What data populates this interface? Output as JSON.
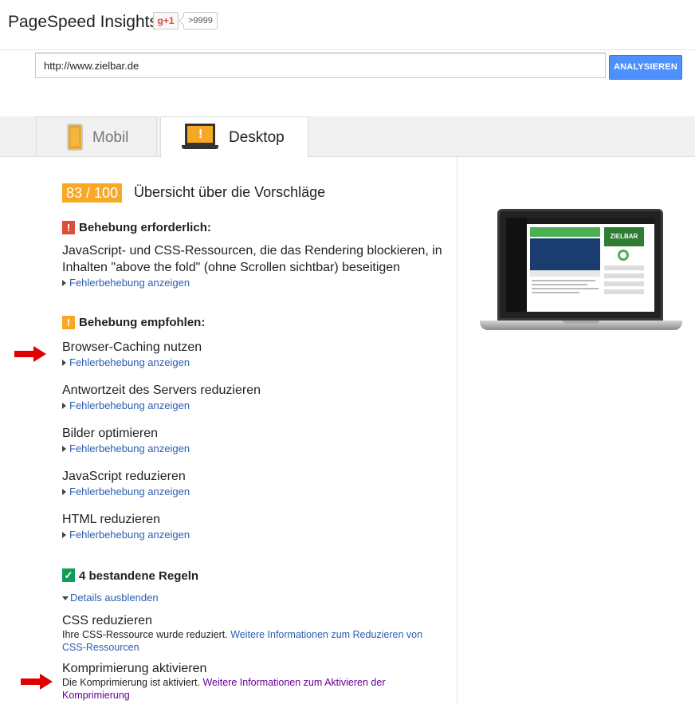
{
  "header": {
    "title": "PageSpeed Insights",
    "gplus_label": "g+1",
    "gplus_count": ">9999"
  },
  "search": {
    "url": "http://www.zielbar.de",
    "button_label": "ANALYSIEREN"
  },
  "tabs": [
    {
      "label": "Mobil",
      "active": false
    },
    {
      "label": "Desktop",
      "active": true
    }
  ],
  "summary": {
    "score": "83 / 100",
    "title": "Übersicht über die Vorschläge",
    "score_color": "#f9a825"
  },
  "sections": {
    "required": {
      "icon": "!",
      "heading": "Behebung erforderlich:",
      "rules": [
        {
          "title": "JavaScript- und CSS-Ressourcen, die das Rendering blockieren, in Inhalten \"above the fold\" (ohne Scrollen sichtbar) beseitigen",
          "link": "Fehlerbehebung anzeigen"
        }
      ]
    },
    "recommended": {
      "icon": "!",
      "heading": "Behebung empfohlen:",
      "rules": [
        {
          "title": "Browser-Caching nutzen",
          "link": "Fehlerbehebung anzeigen"
        },
        {
          "title": "Antwortzeit des Servers reduzieren",
          "link": "Fehlerbehebung anzeigen"
        },
        {
          "title": "Bilder optimieren",
          "link": "Fehlerbehebung anzeigen"
        },
        {
          "title": "JavaScript reduzieren",
          "link": "Fehlerbehebung anzeigen"
        },
        {
          "title": "HTML reduzieren",
          "link": "Fehlerbehebung anzeigen"
        }
      ]
    },
    "passed": {
      "icon": "✓",
      "heading": "4 bestandene Regeln",
      "toggle_link": "Details ausblenden",
      "rules": [
        {
          "title": "CSS reduzieren",
          "desc": "Ihre CSS-Ressource wurde reduziert.",
          "link": "Weitere Informationen zum Reduzieren von CSS-Ressourcen"
        },
        {
          "title": "Komprimierung aktivieren",
          "desc": "Die Komprimierung ist aktiviert.",
          "link": "Weitere Informationen zum Aktivieren der Komprimierung"
        }
      ]
    }
  },
  "preview": {
    "site_logo": "ZIELBAR"
  },
  "colors": {
    "link": "#2a5db0",
    "visited_link": "#660099",
    "error": "#dd4b39",
    "warning": "#f9a825",
    "pass": "#0f9d58",
    "button": "#4d90fe"
  }
}
